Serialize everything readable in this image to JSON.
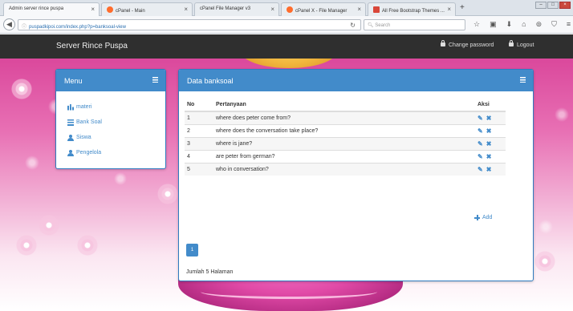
{
  "browser": {
    "tabs": [
      {
        "label": "Admin server rince puspa",
        "active": true
      },
      {
        "label": "cPanel - Main",
        "active": false
      },
      {
        "label": "cPanel File Manager v3",
        "active": false
      },
      {
        "label": "cPanel X - File Manager",
        "active": false
      },
      {
        "label": "All Free Bootstrap Themes ...",
        "active": false
      }
    ],
    "url": "puspadkipoi.com/index.php?p=banksoal-view",
    "search_placeholder": "Search"
  },
  "topbar": {
    "brand": "Server Rince Puspa",
    "change_password": "Change password",
    "logout": "Logout"
  },
  "menu": {
    "title": "Menu",
    "items": [
      {
        "label": "materi",
        "icon": "bar-chart-icon"
      },
      {
        "label": "Bank Soal",
        "icon": "list-icon"
      },
      {
        "label": "Siswa",
        "icon": "user-icon"
      },
      {
        "label": "Pengelola",
        "icon": "user-icon"
      }
    ]
  },
  "banksoal": {
    "title": "Data banksoal",
    "headers": {
      "no": "No",
      "question": "Pertanyaan",
      "action": "Aksi"
    },
    "rows": [
      {
        "no": "1",
        "question": "where does peter come from?"
      },
      {
        "no": "2",
        "question": "where does the conversation take place?"
      },
      {
        "no": "3",
        "question": "where is jane?"
      },
      {
        "no": "4",
        "question": "are peter from german?"
      },
      {
        "no": "5",
        "question": "who in conversation?"
      }
    ],
    "action_edit_glyph": "✎",
    "action_delete_glyph": "✖",
    "add_label": "Add",
    "current_page": "1",
    "footer": "Jumlah 5 Halaman"
  },
  "colors": {
    "primary": "#428bca",
    "topbar": "#2f2f2f",
    "background_pink": "#e870b4"
  }
}
